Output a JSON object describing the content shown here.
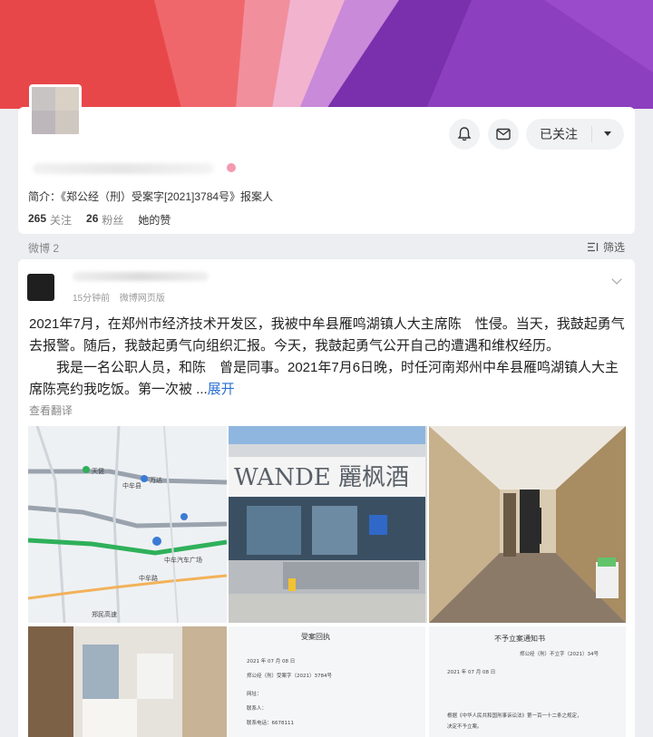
{
  "cover": {
    "colors": [
      "#e8474a",
      "#f06a6e",
      "#f4a7c4",
      "#b266c9",
      "#6f2da8",
      "#8a3bb8"
    ]
  },
  "profile": {
    "bio": "简介：《郑公经（刑）受案字[2021]3784号》报案人",
    "stats": [
      {
        "num": "265",
        "unit": "关注"
      },
      {
        "num": "26",
        "unit": "粉丝"
      }
    ],
    "likes_label": "她的赞",
    "follow_label": "已关注",
    "icons": [
      "bell-icon",
      "message-icon",
      "chevron-down-icon"
    ]
  },
  "feed": {
    "count_label": "微博 2",
    "filter_label": "筛选"
  },
  "post": {
    "time": "15分钟前",
    "source": "微博网页版",
    "para1": "2021年7月，在郑州市经济技术开发区，我被中牟县雁鸣湖镇人大主席陈　性侵。当天，我鼓起勇气去报警。随后，我鼓起勇气向组织汇报。今天，我鼓起勇气公开自己的遭遇和维权经历。",
    "para2": "我是一名公职人员，和陈　曾是同事。2021年7月6日晚，时任河南郑州中牟县雁鸣湖镇人大主席陈亮约我吃饭。第一次被 ...",
    "more_label": "展开",
    "translate_label": "查看翻译",
    "images": {
      "map": {
        "labels": [
          "天健",
          "中牟县",
          "万达",
          "中牟汽车广场",
          "中牟路",
          "郑民高速"
        ]
      },
      "hotel": {
        "sign": "WANDE 麗枫酒"
      },
      "doc1": {
        "title": "受案回执",
        "lines": [
          "2021 年 07 月 08 日",
          "郑公经（刑）受案字（2021）3784号",
          "网址：",
          "联系人：",
          "联系电话：6678111"
        ]
      },
      "doc2": {
        "title": "不予立案通知书",
        "lines": [
          "郑公经（刑）不立字（2021）34号",
          "2021 年 07 月 08 日",
          "根据《中华人民共和国刑事诉讼法》第一百一十二条之规定，",
          "决定不予立案。"
        ]
      }
    }
  }
}
